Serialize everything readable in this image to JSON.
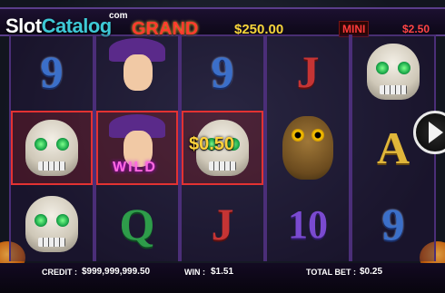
{
  "logo": {
    "slot": "Slot",
    "catalog": "Catalog",
    "sup": "com"
  },
  "jackpots": {
    "grand_label": "GRAND",
    "grand_value": "$250.00",
    "mini_label": "MINI",
    "mini_value": "$2.50"
  },
  "reels": [
    {
      "symbols": [
        "9",
        "skull",
        "skull"
      ]
    },
    {
      "symbols": [
        "witch",
        "witch-wild",
        "Q"
      ]
    },
    {
      "symbols": [
        "9",
        "skull",
        "J"
      ]
    },
    {
      "symbols": [
        "J",
        "owl",
        "10"
      ]
    },
    {
      "symbols": [
        "skull",
        "A",
        "9"
      ]
    }
  ],
  "wins": {
    "highlighted_cells": [
      "reel1-row2",
      "reel2-row2",
      "reel3-row2"
    ],
    "wild_label": "WILD",
    "skull_payout": "$0.50"
  },
  "bottom": {
    "credit_label": "CREDIT :",
    "credit_value": "$999,999,999.50",
    "win_label": "WIN :",
    "win_value": "$1.51",
    "total_bet_label": "TOTAL BET :",
    "total_bet_value": "$0.25"
  },
  "icons": {
    "spin": "play-icon"
  },
  "colors": {
    "grand": "#ff3b2e",
    "grand_value": "#f7d53a",
    "mini": "#ff3a3a",
    "win_highlight": "#e33232",
    "logo_catalog": "#3ec9d6"
  }
}
